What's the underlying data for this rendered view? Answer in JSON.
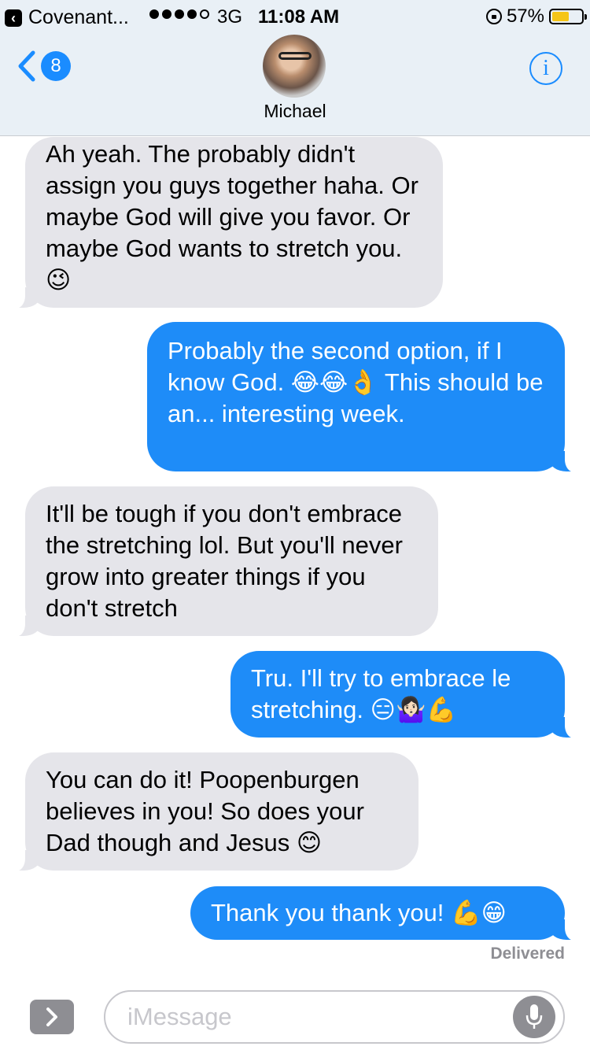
{
  "status_bar": {
    "back_app": "Covenant...",
    "carrier": "3G",
    "time": "11:08 AM",
    "battery": "57%",
    "battery_level": 0.57,
    "battery_color": "#f5c518"
  },
  "header": {
    "back_badge": "8",
    "contact_name": "Michael",
    "info_glyph": "i"
  },
  "messages": [
    {
      "dir": "in",
      "text": "Ah yeah. The probably didn't assign you guys together haha. Or maybe God will give you favor. Or maybe God wants to stretch you. 😉"
    },
    {
      "dir": "out",
      "text": "Probably the second option, if I know God. 😂😂👌 This should be an... interesting week."
    },
    {
      "dir": "in",
      "text": "It'll be tough if you don't embrace the stretching lol. But you'll never grow into greater things if you don't stretch"
    },
    {
      "dir": "out",
      "text": "Tru. I'll try to embrace le stretching. 😑🤷🏻‍♀️💪"
    },
    {
      "dir": "in",
      "text": "You can do it! Poopenburgen believes in you! So does your Dad though and Jesus 😊"
    },
    {
      "dir": "out",
      "text": "Thank you thank you! 💪😁"
    }
  ],
  "delivered": "Delivered",
  "composer": {
    "placeholder": "iMessage",
    "apps_icon": "chevron-right-icon",
    "mic_icon": "microphone-icon"
  },
  "colors": {
    "outgoing": "#1e8cf8",
    "incoming": "#e5e5ea",
    "accent": "#1a8cff"
  }
}
